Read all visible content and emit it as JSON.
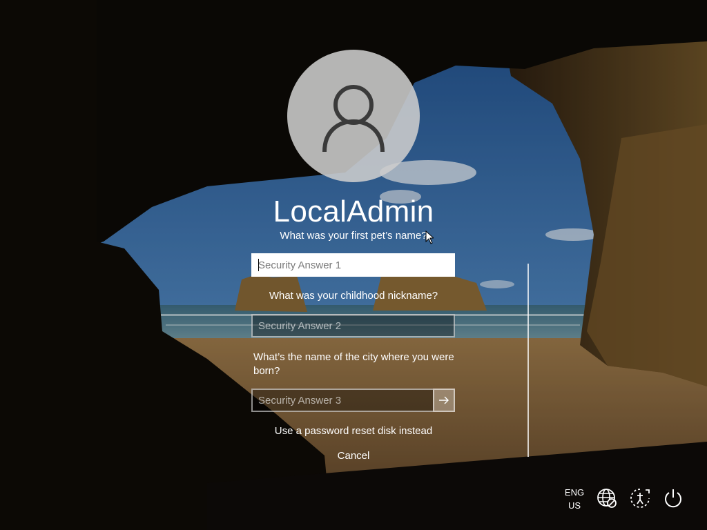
{
  "user": {
    "name": "LocalAdmin"
  },
  "security": {
    "questions": [
      {
        "question": "What was your first pet’s name?",
        "placeholder": "Security Answer 1",
        "value": ""
      },
      {
        "question": "What was your childhood nickname?",
        "placeholder": "Security Answer 2",
        "value": ""
      },
      {
        "question": "What’s the name of the city where you were born?",
        "placeholder": "Security Answer 3",
        "value": ""
      }
    ]
  },
  "links": {
    "reset_disk": "Use a password reset disk instead",
    "cancel": "Cancel"
  },
  "tray": {
    "language_line1": "ENG",
    "language_line2": "US"
  },
  "icons": {
    "avatar": "user-silhouette-icon",
    "submit": "arrow-right-icon",
    "network": "globe-disconnected-icon",
    "ease_of_access": "ease-of-access-icon",
    "power": "power-icon"
  },
  "colors": {
    "text": "#ffffff",
    "focused_field": "#ffffff",
    "avatar_bg": "#cdcdcd"
  }
}
